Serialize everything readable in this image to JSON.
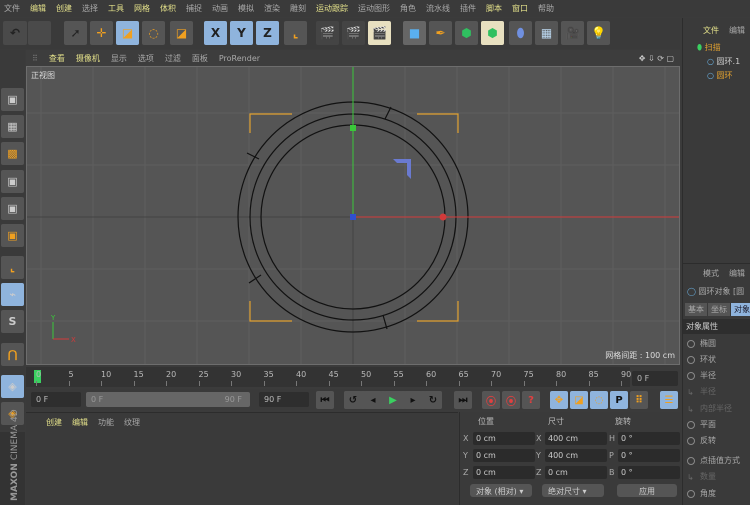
{
  "menu": [
    "文件",
    "编辑",
    "创建",
    "选择",
    "工具",
    "网格",
    "体积",
    "捕捉",
    "动画",
    "模拟",
    "渲染",
    "雕刻",
    "运动跟踪",
    "运动图形",
    "角色",
    "流水线",
    "插件",
    "脚本",
    "窗口",
    "帮助"
  ],
  "menu_highlight": [
    1,
    2,
    4,
    5,
    6,
    12,
    17,
    18
  ],
  "toolbar": {
    "undo": "undo-icon",
    "axes": [
      "X",
      "Y",
      "Z"
    ]
  },
  "viewport": {
    "menu": [
      "查看",
      "摄像机",
      "显示",
      "选项",
      "过滤",
      "面板",
      "ProRender"
    ],
    "view_name": "正视图",
    "grid_spacing": "网格间距 : 100 cm",
    "axis_y": "Y",
    "axis_x": "X"
  },
  "timeline": {
    "ticks": [
      "0",
      "5",
      "10",
      "15",
      "20",
      "25",
      "30",
      "35",
      "40",
      "45",
      "50",
      "55",
      "60",
      "65",
      "70",
      "75",
      "80",
      "85",
      "90"
    ],
    "current_frame": "0 F",
    "start": "0 F",
    "range_start": "0 F",
    "range_end": "90 F",
    "end": "90 F"
  },
  "bottom_tabs": [
    "创建",
    "编辑",
    "功能",
    "纹理"
  ],
  "coords": {
    "headers": [
      "位置",
      "尺寸",
      "旋转"
    ],
    "rows": [
      {
        "a": "X",
        "pos": "0 cm",
        "s": "X",
        "size": "400 cm",
        "r": "H",
        "rot": "0 °"
      },
      {
        "a": "Y",
        "pos": "0 cm",
        "s": "Y",
        "size": "400 cm",
        "r": "P",
        "rot": "0 °"
      },
      {
        "a": "Z",
        "pos": "0 cm",
        "s": "Z",
        "size": "0 cm",
        "r": "B",
        "rot": "0 °"
      }
    ],
    "mode": "对象 (相对)",
    "size_mode": "绝对尺寸",
    "apply": "应用"
  },
  "objects": {
    "tabs": [
      "文件",
      "编辑"
    ],
    "items": [
      "扫描",
      "圆环.1",
      "圆环"
    ]
  },
  "attributes": {
    "tabs": [
      "模式",
      "编辑"
    ],
    "title": "圆环对象 [圆",
    "subtabs": [
      "基本",
      "坐标",
      "对象"
    ],
    "section": "对象属性",
    "props": [
      "椭圆",
      "环状",
      "半径",
      "半径",
      "内部半径",
      "平面",
      "反转",
      "点插值方式",
      "数量",
      "角度"
    ]
  },
  "logo": "MAXON CINEMA 4D",
  "colors": {
    "accent": "#e3e08a",
    "x_axis": "#d23a3a",
    "y_axis": "#3ac83a",
    "selection": "#e0a030",
    "active_tab": "#8fb4dd"
  }
}
